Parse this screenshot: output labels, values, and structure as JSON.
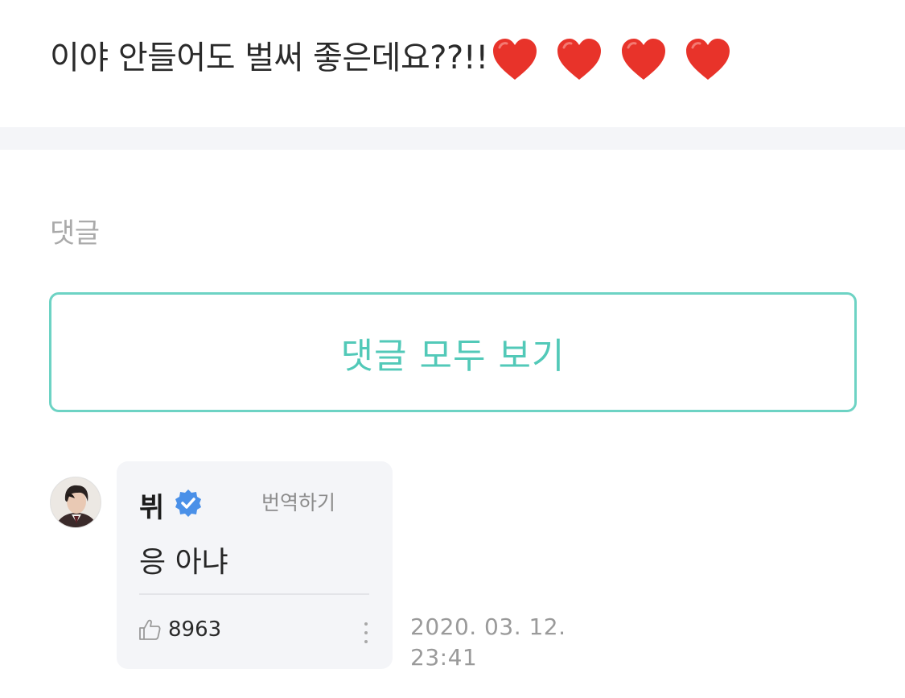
{
  "post": {
    "text": "이야 안들어도 벌써 좋은데요??!!",
    "heart_count": 4,
    "heart_icon": "red-heart-emoji",
    "heart_color": "#e8332a"
  },
  "comments_section": {
    "heading": "댓글",
    "view_all_label": "댓글 모두 보기",
    "accent_color": "#52c9b8"
  },
  "comment": {
    "author": "뷔",
    "verified": true,
    "verified_color": "#4a90e8",
    "translate_label": "번역하기",
    "body": "응 아냐",
    "like_count": "8963",
    "date": "2020. 03. 12.",
    "time": "23:41"
  }
}
